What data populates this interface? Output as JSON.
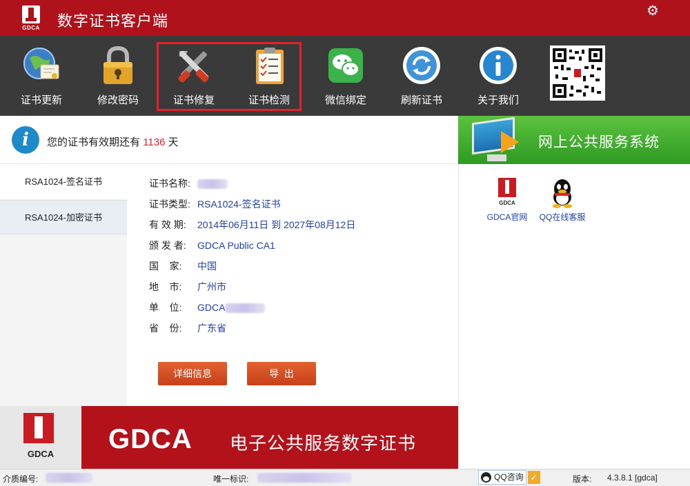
{
  "app": {
    "title": "数字证书客户端",
    "logo_text": "GDCA"
  },
  "toolbar": {
    "items": [
      {
        "label": "证书更新",
        "icon": "globe-certificate-icon"
      },
      {
        "label": "修改密码",
        "icon": "padlock-icon"
      },
      {
        "label": "证书修复",
        "icon": "tools-icon"
      },
      {
        "label": "证书检测",
        "icon": "checklist-icon"
      },
      {
        "label": "微信绑定",
        "icon": "wechat-icon"
      },
      {
        "label": "刷新证书",
        "icon": "refresh-icon"
      },
      {
        "label": "关于我们",
        "icon": "info-icon"
      }
    ]
  },
  "validity": {
    "prefix": "您的证书有效期还有",
    "days": "1136",
    "suffix": "天"
  },
  "side_tabs": [
    "RSA1024-签名证书",
    "RSA1024-加密证书"
  ],
  "cert": {
    "fields": [
      {
        "label": "证书名称:",
        "value": ""
      },
      {
        "label": "证书类型:",
        "value": "RSA1024-签名证书"
      },
      {
        "label": "有 效 期:",
        "value": "2014年06月11日 到 2027年08月12日"
      },
      {
        "label": "颁 发 者:",
        "value": "GDCA Public CA1"
      },
      {
        "label": "国    家:",
        "value": "中国"
      },
      {
        "label": "地    市:",
        "value": "广州市"
      },
      {
        "label": "单    位:",
        "value": "GDCA"
      },
      {
        "label": "省    份:",
        "value": "广东省"
      }
    ]
  },
  "buttons": {
    "details": "详细信息",
    "export": "导  出"
  },
  "banner": {
    "text": "网上公共服务系统"
  },
  "links": {
    "gdca_site": "GDCA官网",
    "qq_service": "QQ在线客服",
    "gdca_logo_text": "GDCA"
  },
  "footer_banner": {
    "brand": "GDCA",
    "slogan": "电子公共服务数字证书",
    "logo_text": "GDCA"
  },
  "status": {
    "medium_label": "介质编号:",
    "uid_label": "唯一标识:",
    "qq_label": "QQ咨询",
    "version_label": "版本:",
    "version_value": "4.3.8.1 [gdca]"
  },
  "colors": {
    "title_red": "#b0121b",
    "toolbar_bg": "#3a3a3a",
    "link_blue": "#1f3fae",
    "days_red": "#e8202a",
    "button_orange": "#d24d22",
    "banner_green": "#3aa52b"
  }
}
